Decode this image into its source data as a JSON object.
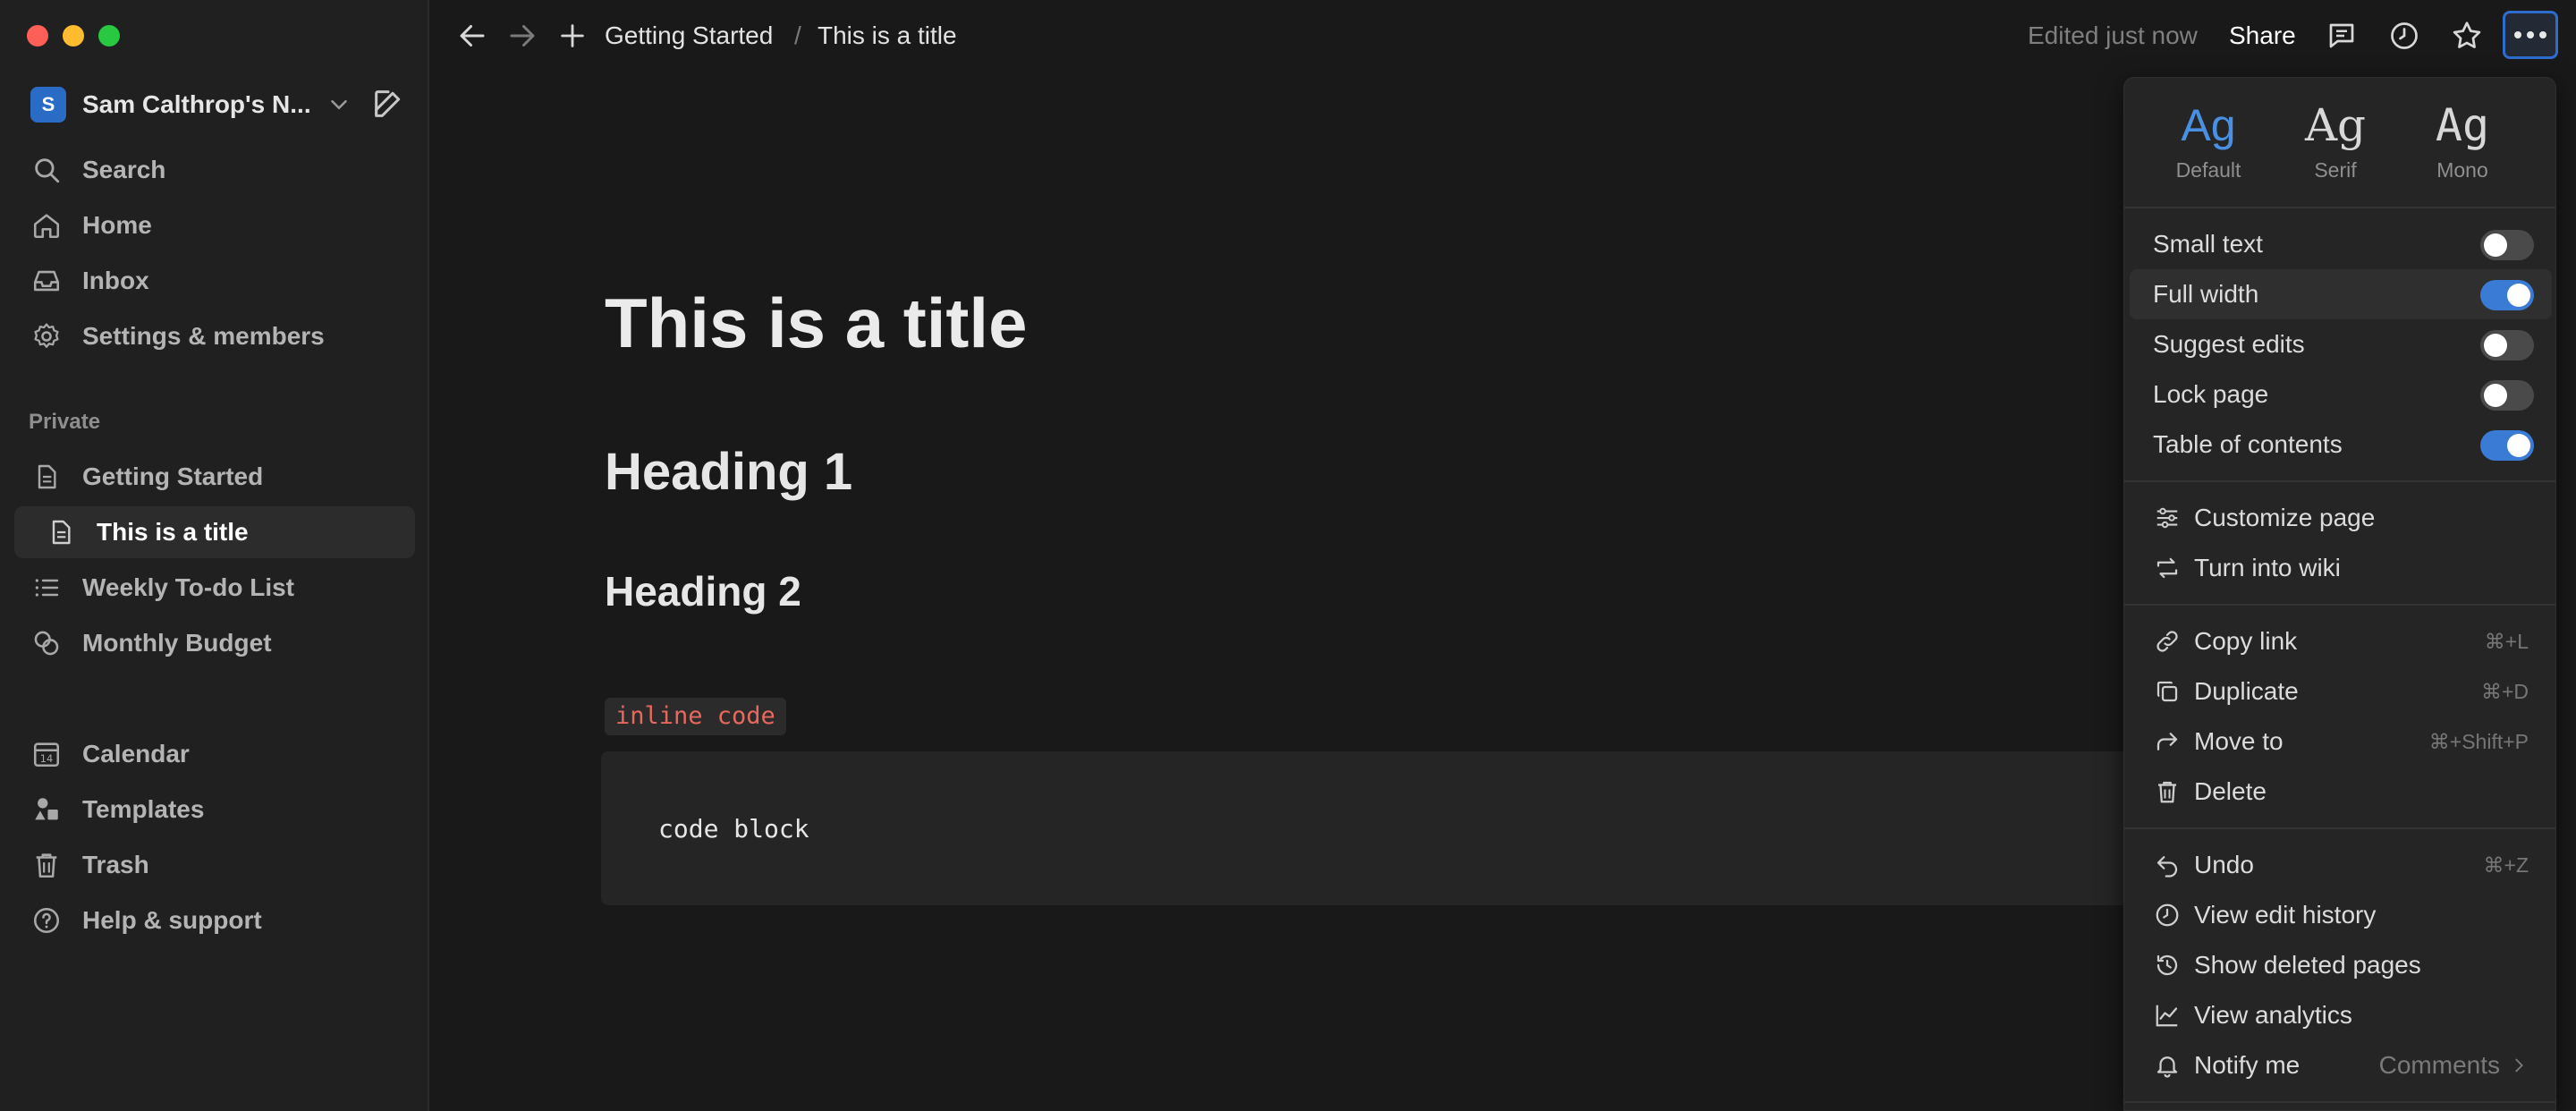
{
  "colors": {
    "accent": "#3a7bd5",
    "inline_code": "#e8685d",
    "traffic_close": "#ff5f57",
    "traffic_min": "#febc2e",
    "traffic_max": "#28c840"
  },
  "sidebar": {
    "workspace": {
      "avatar_letter": "S",
      "name": "Sam Calthrop's N..."
    },
    "top_items": [
      {
        "label": "Search",
        "icon": "search-icon"
      },
      {
        "label": "Home",
        "icon": "home-icon"
      },
      {
        "label": "Inbox",
        "icon": "inbox-icon"
      },
      {
        "label": "Settings & members",
        "icon": "gear-icon"
      }
    ],
    "section_label": "Private",
    "pages": [
      {
        "label": "Getting Started",
        "icon": "page-icon"
      },
      {
        "label": "This is a title",
        "icon": "page-icon",
        "active": true
      },
      {
        "label": "Weekly To-do List",
        "icon": "list-icon"
      },
      {
        "label": "Monthly Budget",
        "icon": "budget-icon"
      }
    ],
    "bottom_items": [
      {
        "label": "Calendar",
        "icon": "calendar-icon"
      },
      {
        "label": "Templates",
        "icon": "templates-icon"
      },
      {
        "label": "Trash",
        "icon": "trash-icon"
      },
      {
        "label": "Help & support",
        "icon": "help-icon"
      }
    ]
  },
  "topbar": {
    "breadcrumb_parent": "Getting Started",
    "breadcrumb_sep": "/",
    "breadcrumb_current": "This is a title",
    "edited": "Edited just now",
    "share": "Share"
  },
  "page": {
    "title": "This is a title",
    "heading1": "Heading 1",
    "heading2": "Heading 2",
    "inline_code": "inline code",
    "code_block": "code block"
  },
  "menu": {
    "fonts": [
      {
        "sample": "Ag",
        "name": "Default",
        "selected": true
      },
      {
        "sample": "Ag",
        "name": "Serif"
      },
      {
        "sample": "Ag",
        "name": "Mono"
      }
    ],
    "toggles": [
      {
        "label": "Small text",
        "on": false
      },
      {
        "label": "Full width",
        "on": true
      },
      {
        "label": "Suggest edits",
        "on": false
      },
      {
        "label": "Lock page",
        "on": false
      },
      {
        "label": "Table of contents",
        "on": true
      }
    ],
    "page_actions": [
      {
        "label": "Customize page",
        "icon": "sliders-icon"
      },
      {
        "label": "Turn into wiki",
        "icon": "convert-icon"
      }
    ],
    "edit_actions": [
      {
        "label": "Copy link",
        "icon": "link-icon",
        "shortcut": "⌘+L"
      },
      {
        "label": "Duplicate",
        "icon": "duplicate-icon",
        "shortcut": "⌘+D"
      },
      {
        "label": "Move to",
        "icon": "move-icon",
        "shortcut": "⌘+Shift+P"
      },
      {
        "label": "Delete",
        "icon": "trash-icon",
        "shortcut": ""
      }
    ],
    "history_actions": [
      {
        "label": "Undo",
        "icon": "undo-icon",
        "shortcut": "⌘+Z"
      },
      {
        "label": "View edit history",
        "icon": "clock-icon"
      },
      {
        "label": "Show deleted pages",
        "icon": "history-icon"
      },
      {
        "label": "View analytics",
        "icon": "analytics-icon"
      },
      {
        "label": "Notify me",
        "icon": "bell-icon",
        "value": "Comments"
      }
    ]
  }
}
